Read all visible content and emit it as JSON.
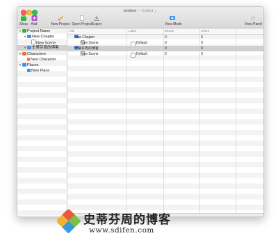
{
  "window": {
    "title": "Untitled",
    "title_suffix": "— Edited ⌄"
  },
  "toolbar": {
    "shop": "Shop",
    "add": "Add",
    "new_project": "New Project",
    "open_project": "Open Project",
    "export": "Export",
    "view_mode": "View Mode",
    "view_panel": "View Panel"
  },
  "sidebar": {
    "items": [
      {
        "label": "Project Name"
      },
      {
        "label": "New Chapter"
      },
      {
        "label": "New Scene"
      },
      {
        "label": "史蒂芬周的博客"
      },
      {
        "label": "Characters"
      },
      {
        "label": "New Character"
      },
      {
        "label": "Places"
      },
      {
        "label": "New Place"
      }
    ]
  },
  "table": {
    "columns": [
      "Title",
      "Label",
      "Words",
      "Chars"
    ],
    "rows": [
      {
        "title": "New Chapter",
        "label": "",
        "words": "0",
        "chars": "0"
      },
      {
        "title": "New Scene",
        "label": "Default",
        "words": "0",
        "chars": "0"
      },
      {
        "title": "史蒂芬周的博客",
        "label": "",
        "words": "0",
        "chars": "0"
      },
      {
        "title": "New Scene",
        "label": "Default",
        "words": "0",
        "chars": "0"
      }
    ]
  },
  "watermark": {
    "text": "史蒂芬周的博客",
    "url": "www.sdifen.com"
  }
}
